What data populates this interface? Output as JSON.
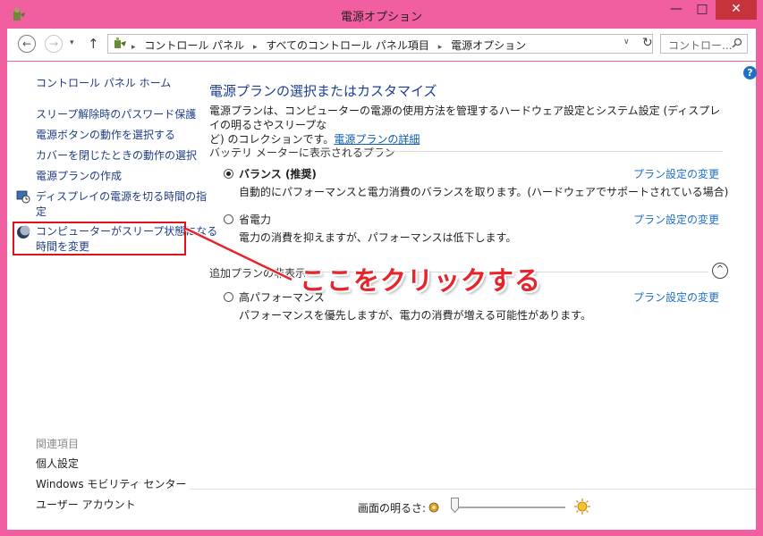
{
  "window": {
    "title": "電源オプション",
    "buttons": {
      "minimize": "—",
      "maximize": "□",
      "close": "✕"
    }
  },
  "address": {
    "back": "←",
    "forward": "→",
    "recent": "▾",
    "up": "↑",
    "crumbs": [
      "コントロール パネル",
      "すべてのコントロール パネル項目",
      "電源オプション"
    ],
    "separator": "▸",
    "dropdown": "∨",
    "refresh": "↻",
    "search_placeholder": "コントロー..."
  },
  "help": "?",
  "sidebar": {
    "home": "コントロール パネル ホーム",
    "items": [
      "スリープ解除時のパスワード保護",
      "電源ボタンの動作を選択する",
      "カバーを閉じたときの動作の選択",
      "電源プランの作成"
    ],
    "display_item": [
      "ディスプレイの電源を切る時間の指",
      "定"
    ],
    "sleep_item": [
      "コンピューターがスリープ状態になる",
      "時間を変更"
    ],
    "related_header": "関連項目",
    "related": [
      "個人設定",
      "Windows モビリティ センター",
      "ユーザー アカウント"
    ]
  },
  "main": {
    "title": "電源プランの選択またはカスタマイズ",
    "desc_line1": "電源プランは、コンピューターの電源の使用方法を管理するハードウェア設定とシステム設定 (ディスプレイの明るさやスリープな",
    "desc_line2_prefix": "ど) のコレクションです。",
    "desc_link": "電源プランの詳細",
    "battery_group": "バッテリ メーターに表示されるプラン",
    "additional_group": "追加プランの非表示",
    "plans": [
      {
        "name": "バランス (推奨)",
        "desc": "自動的にパフォーマンスと電力消費のバランスを取ります。(ハードウェアでサポートされている場合)",
        "link": "プラン設定の変更",
        "selected": true
      },
      {
        "name": "省電力",
        "desc": "電力の消費を抑えますが、パフォーマンスは低下します。",
        "link": "プラン設定の変更",
        "selected": false
      },
      {
        "name": "高パフォーマンス",
        "desc": "パフォーマンスを優先しますが、電力の消費が増える可能性があります。",
        "link": "プラン設定の変更",
        "selected": false
      }
    ],
    "collapse": "^"
  },
  "annotation": "ここをクリックする",
  "brightness": {
    "label": "画面の明るさ:",
    "level": 0
  },
  "colors": {
    "frame": "#f25fa0",
    "close": "#c7333c",
    "annotation": "#e8232b",
    "link": "#1d6fc7",
    "heading": "#1d3e93"
  }
}
